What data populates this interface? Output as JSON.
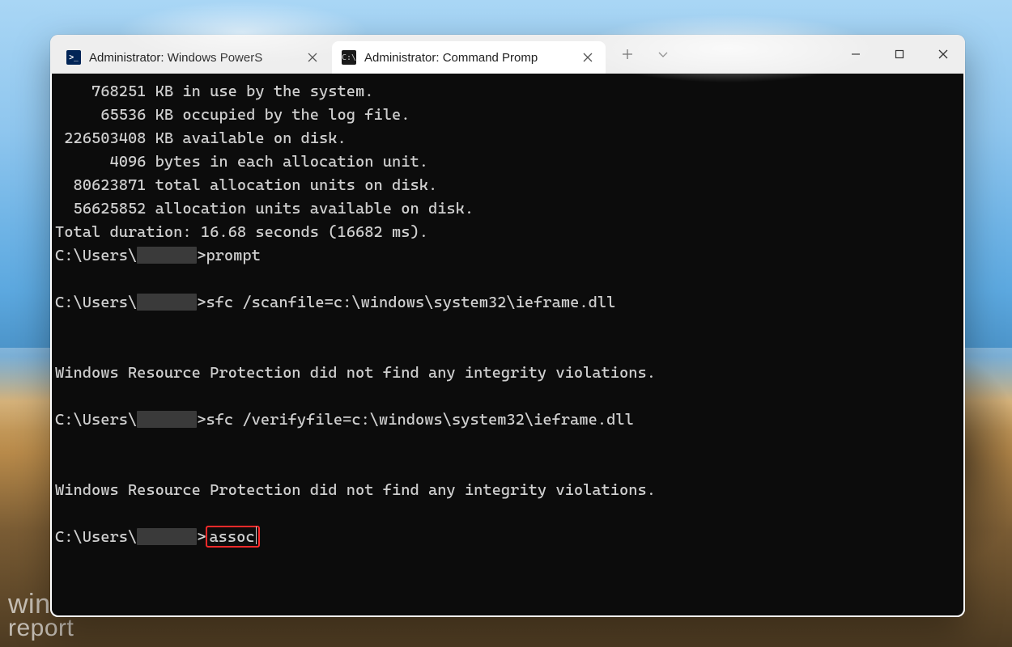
{
  "watermark": {
    "line1": "windows",
    "line2": "report"
  },
  "titlebar": {
    "tabs": [
      {
        "title": "Administrator: Windows PowerS",
        "icon": "powershell-icon",
        "active": false
      },
      {
        "title": "Administrator: Command Promp",
        "icon": "cmd-icon",
        "active": true
      }
    ],
    "new_tab_label": "+",
    "dropdown_label": "v"
  },
  "prompt": {
    "base": "C:\\Users\\",
    "redacted_name": "█████",
    "gt": ">"
  },
  "terminal": {
    "output_head": [
      "    768251 KB in use by the system.",
      "     65536 KB occupied by the log file.",
      " 226503408 KB available on disk.",
      "",
      "      4096 bytes in each allocation unit.",
      "  80623871 total allocation units on disk.",
      "  56625852 allocation units available on disk.",
      "Total duration: 16.68 seconds (16682 ms).",
      ""
    ],
    "cmd_prompt": "prompt",
    "cmd_scan": "sfc /scanfile=c:\\windows\\system32\\ieframe.dll",
    "msg_no_violations": "Windows Resource Protection did not find any integrity violations.",
    "cmd_verify": "sfc /verifyfile=c:\\windows\\system32\\ieframe.dll",
    "cmd_current": "assoc"
  }
}
